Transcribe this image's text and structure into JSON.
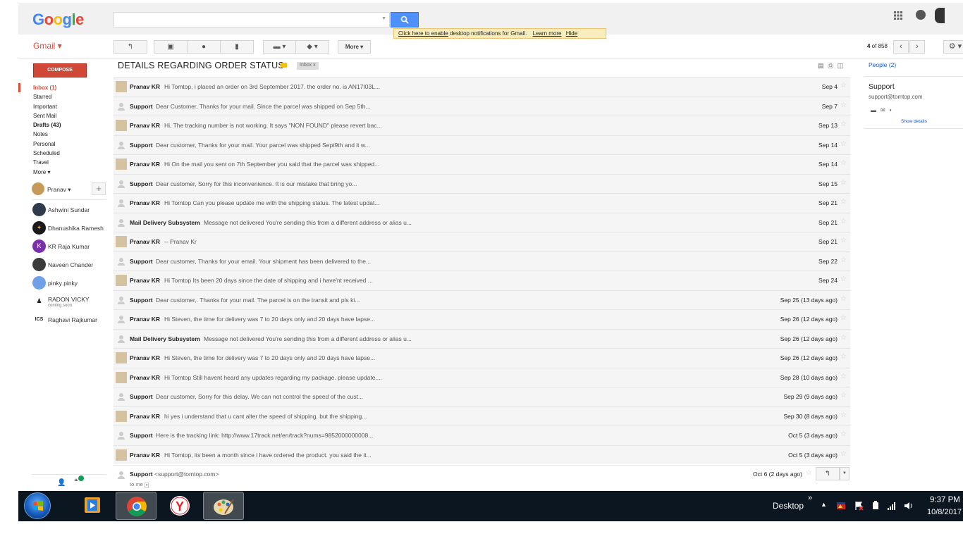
{
  "header": {
    "logo": "Google",
    "search_value": "",
    "notification": {
      "text1": "Click here to enable",
      "text2": " desktop notifications for Gmail.",
      "learn_more": "Learn more",
      "hide": "Hide"
    }
  },
  "toolbar": {
    "app_label": "Gmail ▾",
    "more_label": "More ▾",
    "page_range": "4",
    "page_total": " of 858"
  },
  "sidebar": {
    "compose_label": "COMPOSE",
    "items": [
      {
        "label": "Inbox (1)"
      },
      {
        "label": "Starred"
      },
      {
        "label": "Important"
      },
      {
        "label": "Sent Mail"
      },
      {
        "label": "Drafts (43)"
      },
      {
        "label": "Notes"
      },
      {
        "label": "Personal"
      },
      {
        "label": "Scheduled"
      },
      {
        "label": "Travel"
      },
      {
        "label": "More ▾"
      }
    ],
    "hangout_user": "Pranav ▾",
    "contacts": [
      {
        "name": "Ashwini Sundar",
        "initial": ""
      },
      {
        "name": "Dhanushika Ramesh",
        "initial": ""
      },
      {
        "name": "KR Raja Kumar",
        "initial": "K"
      },
      {
        "name": "Naveen Chander",
        "initial": ""
      },
      {
        "name": "pinky pinky",
        "initial": ""
      },
      {
        "name": "RADON VICKY",
        "initial": "",
        "status": "coming soon"
      },
      {
        "name": "Raghavi Rajkumar",
        "initial": ""
      }
    ]
  },
  "thread": {
    "title": "DETAILS REGARDING ORDER STATUS",
    "label_chip": "Inbox   x",
    "messages": [
      {
        "sender": "Pranav KR",
        "snippet": "Hi Tomtop, i placed an order on 3rd September 2017. the order no. is AN17I03L...",
        "date": "Sep 4",
        "photo": true
      },
      {
        "sender": "Support",
        "snippet": "Dear Customer, Thanks for your mail. Since the parcel was shipped on Sep 5th...",
        "date": "Sep 7",
        "photo": false
      },
      {
        "sender": "Pranav KR",
        "snippet": "Hi, The tracking number is not working. It says \"NON FOUND\" please revert bac...",
        "date": "Sep 13",
        "photo": true
      },
      {
        "sender": "Support",
        "snippet": "Dear customer, Thanks for your mail. Your parcel was shipped Sept9th and it w...",
        "date": "Sep 14",
        "photo": false
      },
      {
        "sender": "Pranav KR",
        "snippet": "Hi On the mail you sent on 7th September you said that the parcel was shipped...",
        "date": "Sep 14",
        "photo": true
      },
      {
        "sender": "Support",
        "snippet": "Dear customer, Sorry for this inconvenience. It is our mistake that bring yo...",
        "date": "Sep 15",
        "photo": false
      },
      {
        "sender": "Pranav KR",
        "snippet": "Hi Tomtop Can you please update me with the shipping status. The latest updat...",
        "date": "Sep 21",
        "photo": false
      },
      {
        "sender": "Mail Delivery Subsystem",
        "snippet": "Message not delivered You're sending this from a different address or alias u...",
        "date": "Sep 21",
        "photo": false
      },
      {
        "sender": "Pranav KR",
        "snippet": "-- Pranav Kr",
        "date": "Sep 21",
        "photo": true
      },
      {
        "sender": "Support",
        "snippet": "Dear customer, Thanks for your email. Your shipment has been delivered to the...",
        "date": "Sep 22",
        "photo": false
      },
      {
        "sender": "Pranav KR",
        "snippet": "Hi Tomtop Its been 20 days since the date of shipping and i have'nt received ...",
        "date": "Sep 24",
        "photo": true
      },
      {
        "sender": "Support",
        "snippet": "Dear customer,. Thanks for your mail. The parcel is on the transit and pls ki...",
        "date": "Sep 25 (13 days ago)",
        "photo": false
      },
      {
        "sender": "Pranav KR",
        "snippet": "Hi Steven, the time for delivery was 7 to 20 days only and 20 days have lapse...",
        "date": "Sep 26 (12 days ago)",
        "photo": false
      },
      {
        "sender": "Mail Delivery Subsystem",
        "snippet": "Message not delivered You're sending this from a different address or alias u...",
        "date": "Sep 26 (12 days ago)",
        "photo": false
      },
      {
        "sender": "Pranav KR",
        "snippet": "Hi Steven, the time for delivery was 7 to 20 days only and 20 days have lapse...",
        "date": "Sep 26 (12 days ago)",
        "photo": true
      },
      {
        "sender": "Pranav KR",
        "snippet": "Hi Tomtop Still havent heard any updates regarding my package. please update....",
        "date": "Sep 28 (10 days ago)",
        "photo": true
      },
      {
        "sender": "Support",
        "snippet": "Dear customer, Sorry for this delay. We can not control the speed of the cust...",
        "date": "Sep 29 (9 days ago)",
        "photo": false
      },
      {
        "sender": "Pranav KR",
        "snippet": "hi yes i understand that u cant alter the speed of shipping. but the shipping...",
        "date": "Sep 30 (8 days ago)",
        "photo": true
      },
      {
        "sender": "Support",
        "snippet": "Here is the tracking link: http://www.17track.net/en/track?nums=9852000000008...",
        "date": "Oct 5 (3 days ago)",
        "photo": false
      },
      {
        "sender": "Pranav KR",
        "snippet": "Hi Tomtop, its been a month since i have ordered the product. you said the it...",
        "date": "Oct 5 (3 days ago)",
        "photo": true
      }
    ],
    "open_message": {
      "sender": "Support",
      "email": "<support@tomtop.com>",
      "to_me": "to me",
      "date": "Oct 6 (2 days ago)"
    }
  },
  "right_panel": {
    "people": "People (2)",
    "name": "Support",
    "email": "support@tomtop.com",
    "show_details": "Show details"
  },
  "taskbar": {
    "desktop": "Desktop",
    "time": "9:37 PM",
    "date": "10/8/2017"
  },
  "colors": {
    "accent_red": "#dd4b39",
    "search_blue": "#4d90fe",
    "banner_yellow": "#f9edbe",
    "taskbar": "#0c1620"
  }
}
